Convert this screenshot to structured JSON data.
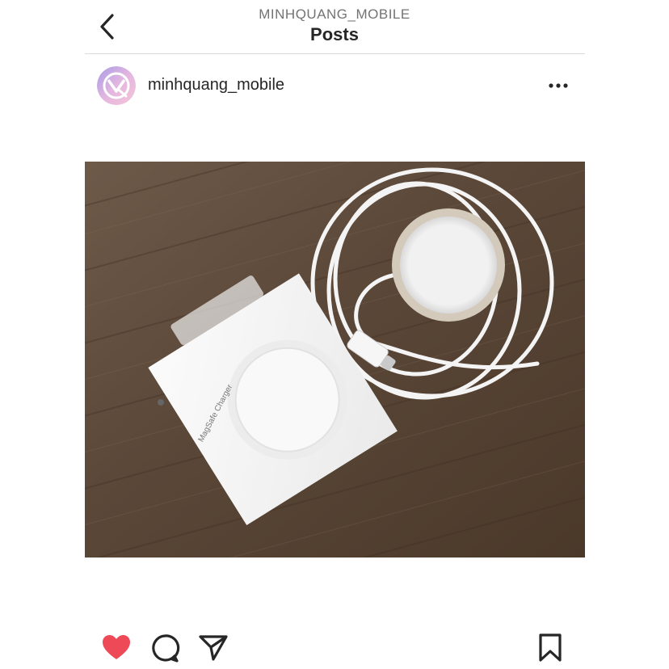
{
  "header": {
    "account": "MINHQUANG_MOBILE",
    "title": "Posts",
    "back_icon": "chevron-left-icon"
  },
  "post": {
    "username": "minhquang_mobile",
    "avatar_icon": "mq-logo-avatar",
    "more_icon": "more-horizontal-icon",
    "photo": {
      "box_print": "MagSafe Charger",
      "subject": "MagSafe charger box and charging puck with USB-C cable on wooden table"
    },
    "liked": true
  },
  "actions": {
    "like_icon": "heart-icon",
    "comment_icon": "comment-icon",
    "share_icon": "paper-plane-icon",
    "save_icon": "bookmark-icon"
  },
  "colors": {
    "like": "#ed4956",
    "text": "#262626",
    "muted": "#737373",
    "divider": "#dbdbdb"
  }
}
